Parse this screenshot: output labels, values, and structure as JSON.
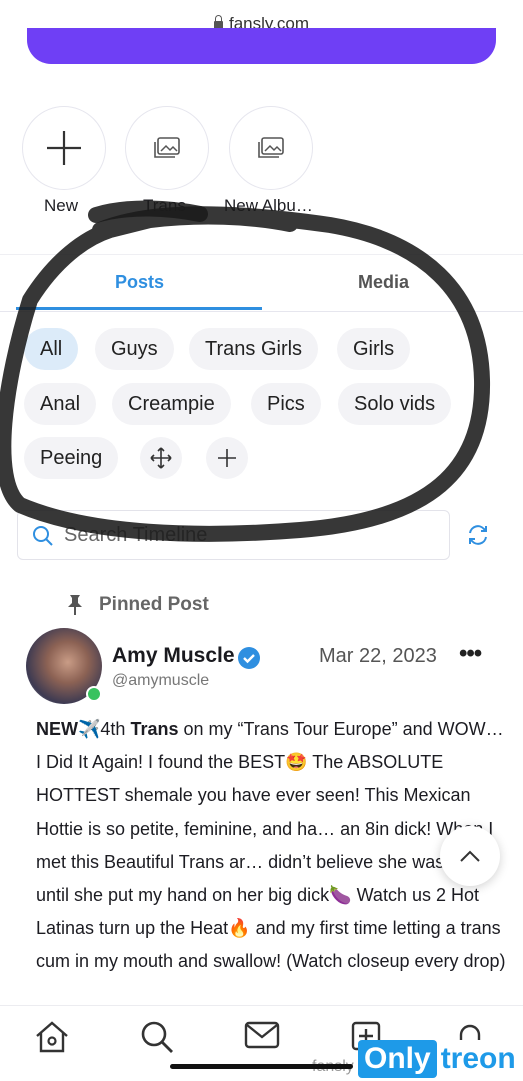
{
  "browser": {
    "url": "fansly.com"
  },
  "albums": [
    {
      "label": "New",
      "icon": "plus-icon"
    },
    {
      "label": "Trans",
      "icon": "gallery-icon"
    },
    {
      "label": "New Albu…",
      "icon": "gallery-icon"
    }
  ],
  "tabs": {
    "posts": "Posts",
    "media": "Media",
    "active": "Posts"
  },
  "filters": [
    "All",
    "Guys",
    "Trans Girls",
    "Girls",
    "Anal",
    "Creampie",
    "Pics",
    "Solo vids",
    "Peeing"
  ],
  "filter_active": "All",
  "search": {
    "placeholder": "Search Timeline"
  },
  "post": {
    "pinned_label": "Pinned Post",
    "author_name": "Amy Muscle",
    "author_handle": "@amymuscle",
    "date": "Mar 22, 2023",
    "more": "•••",
    "text_prefix": "NEW",
    "text_after_plane": "4th ",
    "text_trans": "Trans",
    "text_line1_rest": " on my “Trans Tour Europe” and WOW… I Did It Again! I found the BEST",
    "text_after_emoji": " The ABSOLUTE HOTTEST shemale you have ever seen! This Mexican Hottie is so petite, feminine, and ha… an 8in dick! When I met this Beautiful Trans ar… didn’t believe she was trans until she put my hand on her big dick",
    "text_after_eggplant": " Watch us 2 Hot Latinas turn up the Heat",
    "text_after_fire": " and my first time letting a trans cum in my mouth and swallow! (Watch closeup every drop)"
  },
  "bottom_nav": [
    "home-icon",
    "search-icon",
    "mail-icon",
    "create-icon",
    "notifications-icon"
  ],
  "footer_watermark_text": "fansly",
  "brand": {
    "part1": "Only",
    "part2": "treon"
  },
  "colors": {
    "accent": "#2f8fe0",
    "purple": "#6f3ff5",
    "online": "#38c25f",
    "brand": "#1e9ae8"
  }
}
